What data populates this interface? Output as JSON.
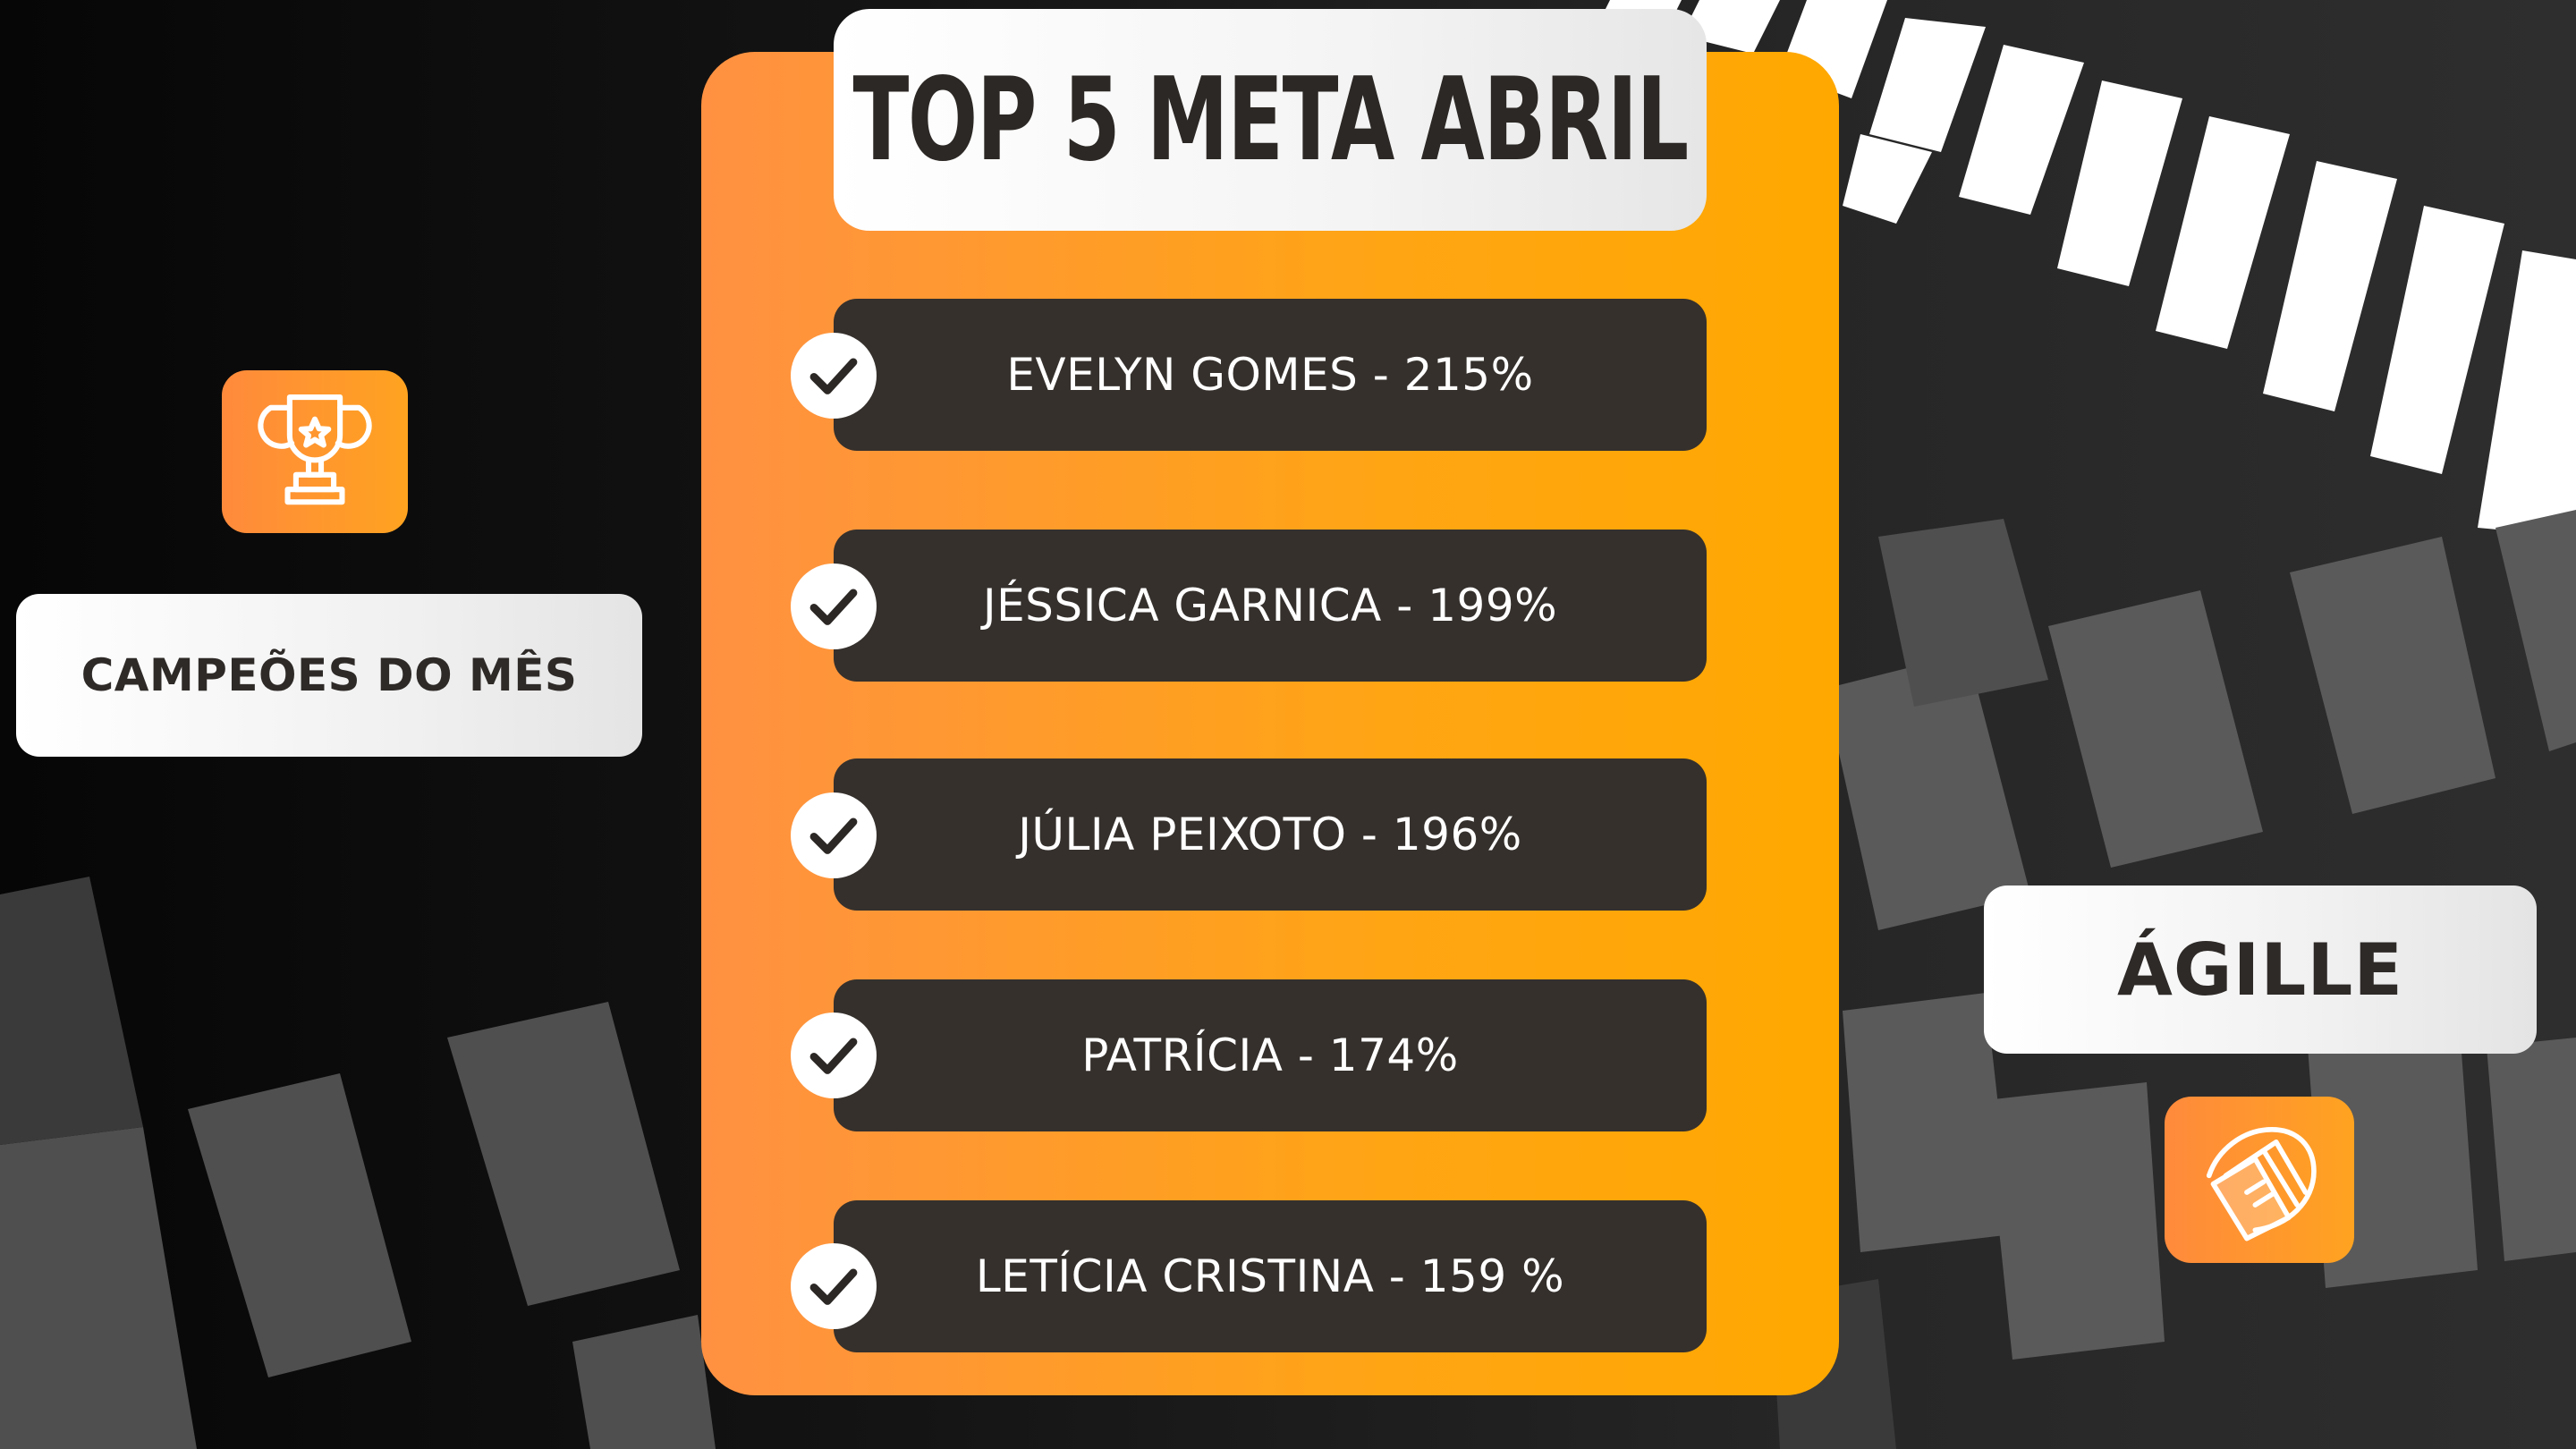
{
  "title": "TOP 5 META ABRIL",
  "ranking": [
    {
      "text": "EVELYN GOMES - 215%"
    },
    {
      "text": "JÉSSICA GARNICA - 199%"
    },
    {
      "text": "JÚLIA PEIXOTO - 196%"
    },
    {
      "text": "PATRÍCIA - 174%"
    },
    {
      "text": "LETÍCIA CRISTINA - 159 %"
    }
  ],
  "left_label": "CAMPEÕES DO MÊS",
  "right_label": "ÁGILLE",
  "icons": {
    "trophy": "trophy-icon",
    "money": "money-bills-icon",
    "check": "check-circle-icon"
  },
  "colors": {
    "accent_orange": "#ffa514",
    "bar_dark": "#35302c",
    "text_dark": "#2c2825"
  }
}
